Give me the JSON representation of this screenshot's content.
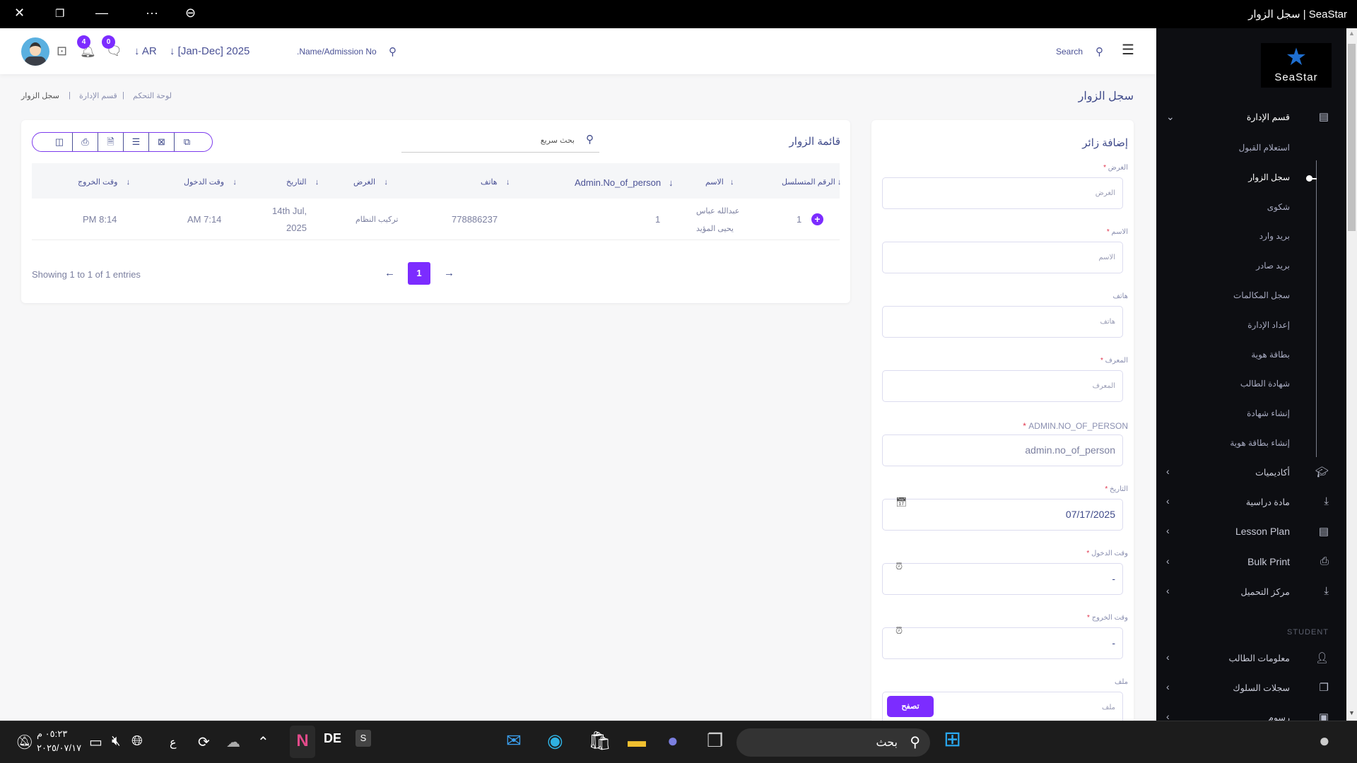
{
  "window": {
    "title": "سجل الزوار | SeaStar",
    "controls": [
      "close-icon",
      "restore-icon",
      "minimize-icon",
      "more-icon",
      "zoom-out-icon"
    ]
  },
  "header": {
    "notifications_count": "4",
    "messages_count": "0",
    "language": "AR",
    "period": "[Jan-Dec] 2025",
    "student_search_placeholder": ".Name/Admission No",
    "search_label": "Search"
  },
  "breadcrumb": {
    "items": [
      "لوحة التحكم",
      "قسم الإدارة",
      "سجل الزوار"
    ],
    "page_title": "سجل الزوار"
  },
  "visitors_list": {
    "title": "قائمة الزوار",
    "quick_search_placeholder": "بحث سريع",
    "toolbar": [
      "columns-icon",
      "print-icon",
      "pdf-icon",
      "csv-icon",
      "excel-icon",
      "copy-icon"
    ],
    "columns": [
      "الرقم المتسلسل",
      "الاسم",
      "Admin.No_of_person",
      "هاتف",
      "الغرض",
      "التاريخ",
      "وقت الدخول",
      "وقت الخروج"
    ],
    "rows": [
      {
        "serial": "1",
        "name_line1": "عبدالله عباس",
        "name_line2": "يحيى المؤيد",
        "admin_no": "1",
        "phone": "778886237",
        "purpose": "تركيب النظام",
        "date_line1": "14th Jul,",
        "date_line2": "2025",
        "entry": "AM 7:14",
        "exit": "PM 8:14"
      }
    ],
    "info": "Showing 1 to 1 of 1 entries",
    "pagination": {
      "current": "1"
    }
  },
  "add_visitor": {
    "title": "إضافة زائر",
    "fields": [
      {
        "label": "الغرض",
        "required": true,
        "placeholder": "الغرض",
        "value": ""
      },
      {
        "label": "الاسم",
        "required": true,
        "placeholder": "الاسم",
        "value": ""
      },
      {
        "label": "هاتف",
        "required": false,
        "placeholder": "هاتف",
        "value": ""
      },
      {
        "label": "المعرف",
        "required": true,
        "placeholder": "المعرف",
        "value": ""
      },
      {
        "label": "ADMIN.NO_OF_PERSON",
        "required": true,
        "placeholder": "admin.no_of_person",
        "value": ""
      },
      {
        "label": "التاريخ",
        "required": true,
        "placeholder": "",
        "value": "07/17/2025"
      },
      {
        "label": "وقت الدخول",
        "required": true,
        "placeholder": "",
        "value": "-"
      },
      {
        "label": "وقت الخروج",
        "required": true,
        "placeholder": "",
        "value": "-"
      },
      {
        "label": "ملف",
        "required": false,
        "placeholder": "ملف",
        "value": ""
      }
    ],
    "browse_label": "تصفح"
  },
  "sidebar": {
    "logo_text": "SeaStar",
    "section_main": "قسم الإدارة",
    "sub_items": [
      "استعلام القبول",
      "سجل الزوار",
      "شكوى",
      "بريد وارد",
      "بريد صادر",
      "سجل المكالمات",
      "إعداد الإدارة",
      "بطاقة هوية",
      "شهادة الطالب",
      "إنشاء شهادة",
      "إنشاء بطاقة هوية"
    ],
    "active_sub": "سجل الزوار",
    "groups": [
      "أكاديميات",
      "مادة دراسية",
      "Lesson Plan",
      "Bulk Print",
      "مركز التحميل"
    ],
    "student_title": "STUDENT",
    "student_items": [
      "معلومات الطالب",
      "سجلات السلوك",
      "رسوم"
    ]
  },
  "taskbar": {
    "time": "٠٥:٢٣ م",
    "date": "٢٠٢٥/٠٧/١٧",
    "search_placeholder": "بحث",
    "lang_indicator": "ع",
    "apps": [
      "DE",
      "S"
    ]
  },
  "colors": {
    "accent": "#7c2cff",
    "sidebar_bg": "#0d0e12",
    "text": "#4a5195"
  }
}
